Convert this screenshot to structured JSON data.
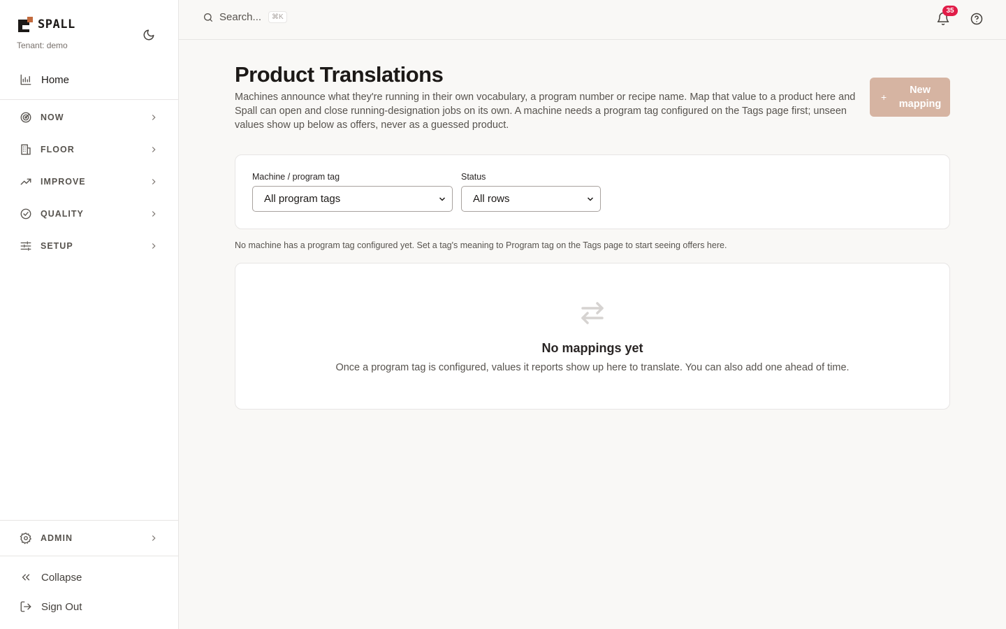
{
  "brand": {
    "name": "SPALL",
    "tenant": "Tenant: demo"
  },
  "sidebar": {
    "home": "Home",
    "groups": [
      {
        "label": "NOW",
        "icon": "radar-icon"
      },
      {
        "label": "FLOOR",
        "icon": "building-icon"
      },
      {
        "label": "IMPROVE",
        "icon": "trending-up-icon"
      },
      {
        "label": "QUALITY",
        "icon": "check-circle-icon"
      },
      {
        "label": "SETUP",
        "icon": "sliders-icon"
      }
    ],
    "admin": "ADMIN",
    "collapse": "Collapse",
    "signout": "Sign Out"
  },
  "topbar": {
    "search_placeholder": "Search...",
    "search_shortcut": "⌘K",
    "notifications_count": "35"
  },
  "page": {
    "title": "Product Translations",
    "description": "Machines announce what they're running in their own vocabulary, a program number or recipe name. Map that value to a product here and Spall can open and close running-designation jobs on its own. A machine needs a program tag configured on the Tags page first; unseen values show up below as offers, never as a guessed product.",
    "new_button_label": "New mapping"
  },
  "filters": {
    "machine_label": "Machine / program tag",
    "machine_value": "All program tags",
    "status_label": "Status",
    "status_value": "All rows"
  },
  "hint": "No machine has a program tag configured yet. Set a tag's meaning to Program tag on the Tags page to start seeing offers here.",
  "empty_state": {
    "title": "No mappings yet",
    "text": "Once a program tag is configured, values it reports show up here to translate. You can also add one ahead of time."
  },
  "colors": {
    "accent": "#c26a3d",
    "button_disabled": "#d6b4a2",
    "badge": "#e11d48",
    "background": "#f9f8f6"
  }
}
